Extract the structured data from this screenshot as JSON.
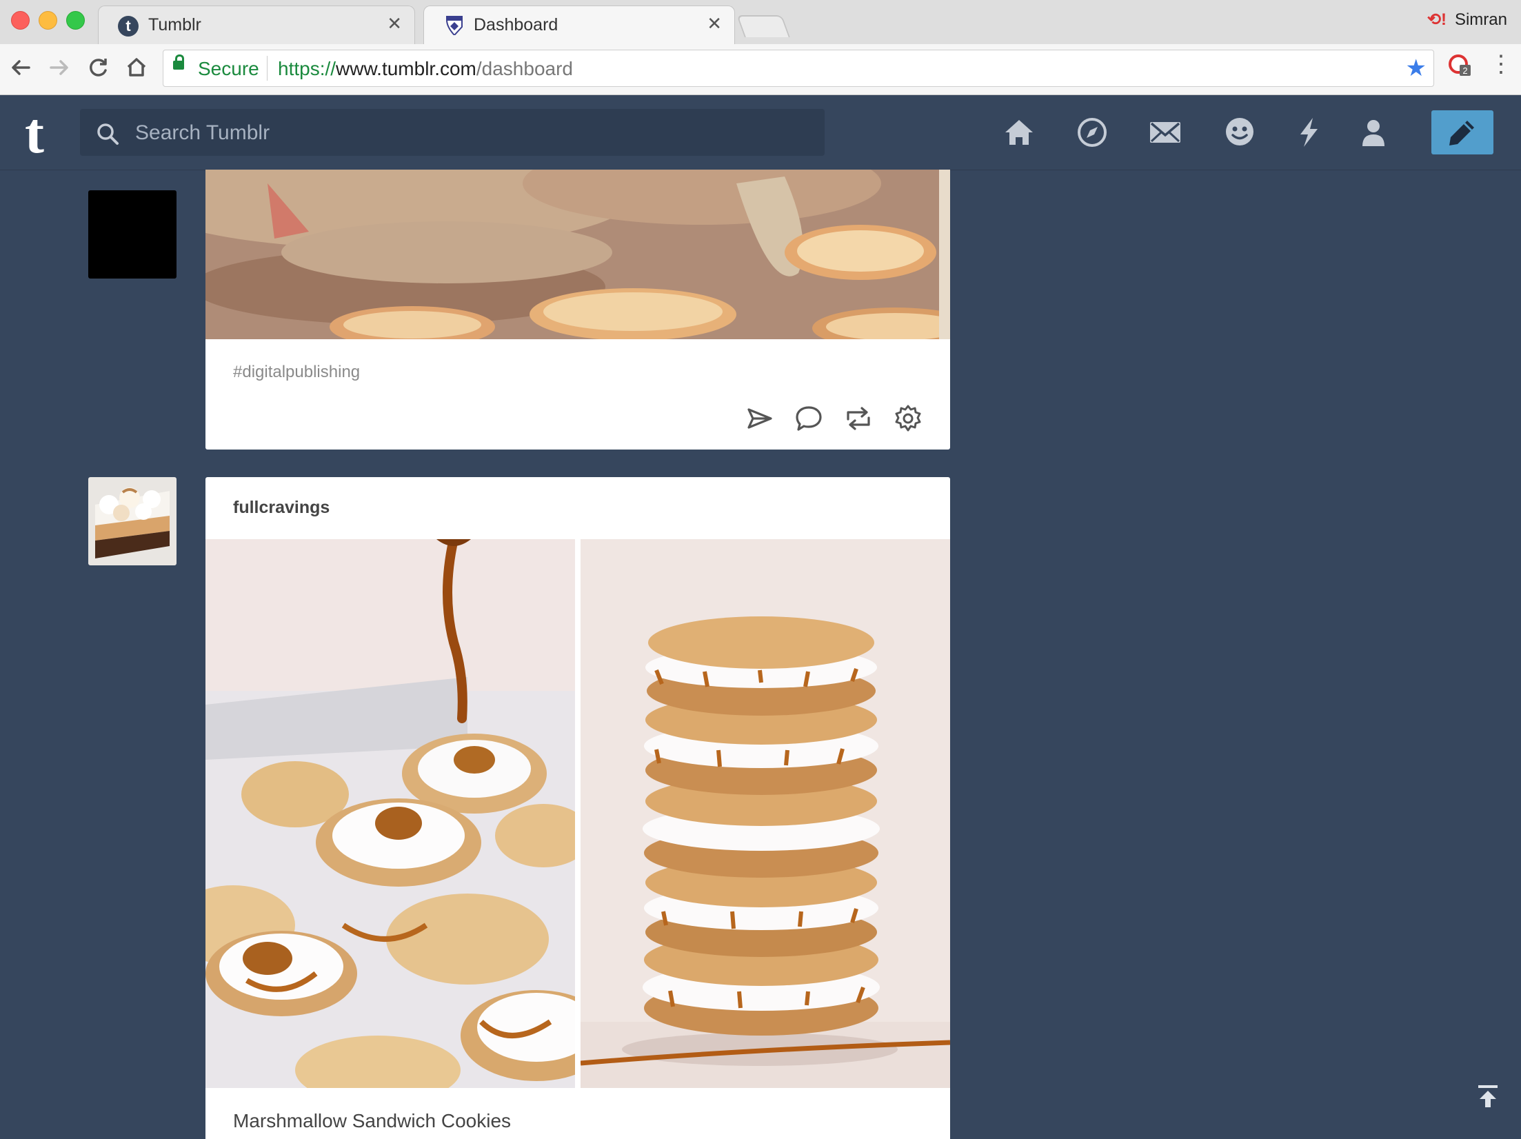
{
  "browser": {
    "tabs": [
      {
        "title": "Tumblr",
        "active": false
      },
      {
        "title": "Dashboard",
        "active": true
      }
    ],
    "profile_name": "Simran",
    "address": {
      "security_label": "Secure",
      "url_scheme": "https://",
      "url_host": "www.tumblr.com",
      "url_path": "/dashboard"
    },
    "extension_badge": "2"
  },
  "header": {
    "logo": "t",
    "search_placeholder": "Search Tumblr",
    "nav_icons": [
      "home-icon",
      "explore-icon",
      "inbox-icon",
      "messaging-icon",
      "activity-icon",
      "account-icon"
    ],
    "compose_icon": "pencil-icon",
    "accent_color": "#529ecc",
    "bg_color": "#36465d"
  },
  "feed": {
    "post1": {
      "tag": "#digitalpublishing",
      "actions": [
        "share-icon",
        "reply-icon",
        "reblog-icon",
        "settings-icon"
      ]
    },
    "post2": {
      "blog_name": "fullcravings",
      "caption": "Marshmallow Sandwich Cookies"
    }
  }
}
